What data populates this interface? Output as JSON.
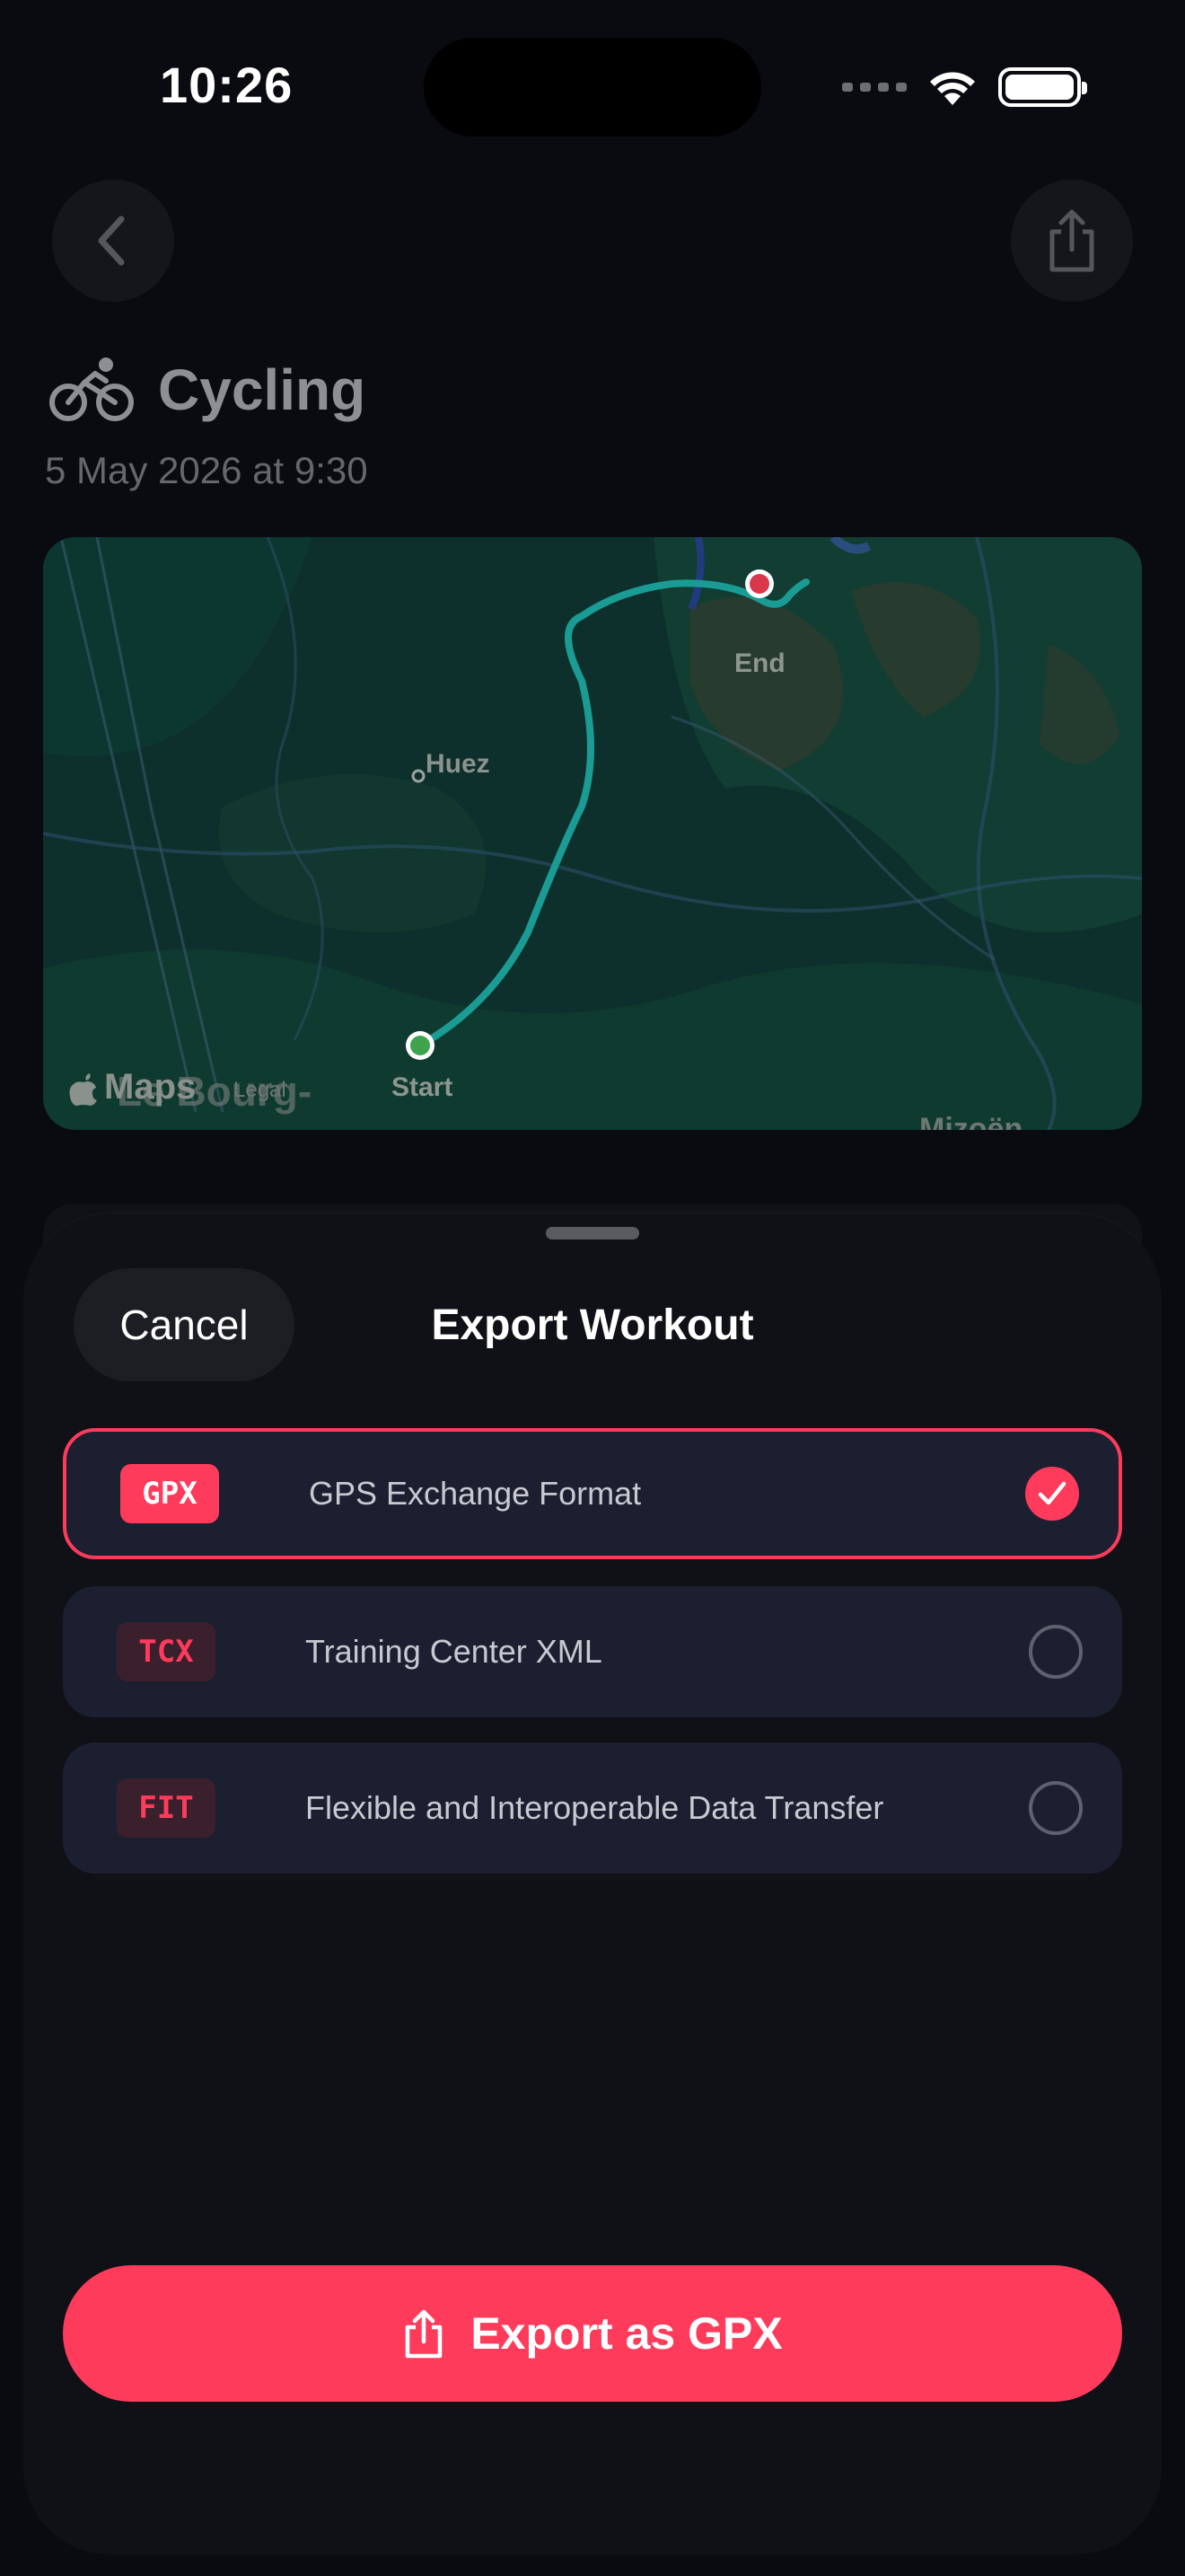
{
  "status": {
    "time": "10:26"
  },
  "workout": {
    "title": "Cycling",
    "date": "5 May 2026 at 9:30"
  },
  "map": {
    "place_label": "Huez",
    "start_label": "Start",
    "end_label": "End",
    "brand": "Maps",
    "legal": "Legal",
    "town_bottom_left": "Le Bourg-",
    "town_bottom_right": "Mizoën",
    "route_color": "#1a9c95",
    "start_color": "#3fa34d",
    "end_color": "#d9384a"
  },
  "sheet": {
    "cancel_label": "Cancel",
    "title": "Export Workout",
    "options": [
      {
        "badge": "GPX",
        "label": "GPS Exchange Format",
        "selected": true
      },
      {
        "badge": "TCX",
        "label": "Training Center XML",
        "selected": false
      },
      {
        "badge": "FIT",
        "label": "Flexible and Interoperable Data Transfer",
        "selected": false
      }
    ],
    "export_label": "Export as GPX"
  },
  "colors": {
    "accent": "#ff3b5c",
    "sheet_bg": "#101116",
    "option_bg": "#1c1f30"
  },
  "icons": {
    "back": "chevron-left-icon",
    "share": "share-icon",
    "activity": "bicycle-icon",
    "selected": "checkmark-icon",
    "export": "share-icon"
  }
}
